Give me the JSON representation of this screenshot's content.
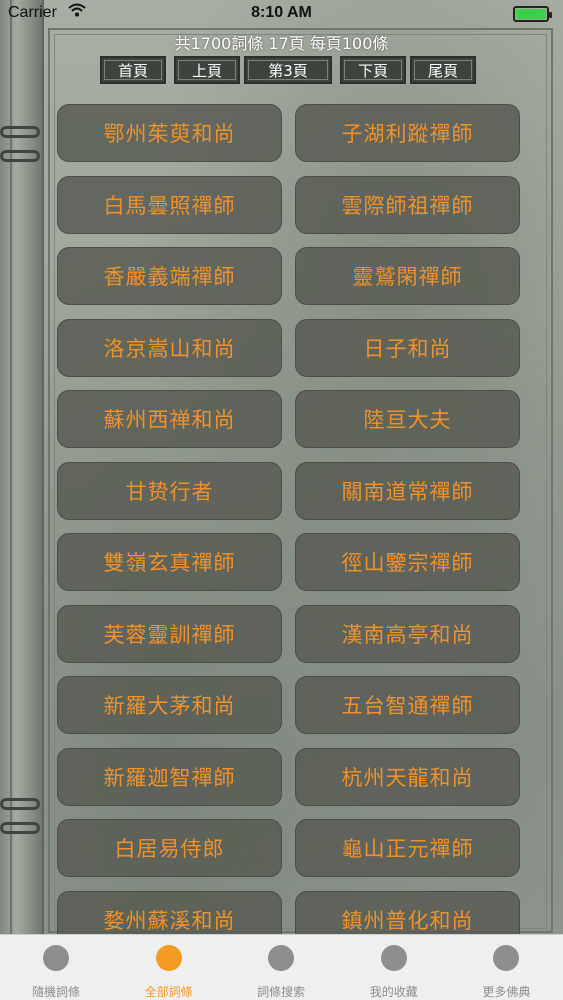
{
  "status_bar": {
    "carrier": "Carrier",
    "time": "8:10 AM"
  },
  "summary": "共1700詞條 17頁 每頁100條",
  "pager": {
    "first": "首頁",
    "prev": "上頁",
    "current": "第3頁",
    "next": "下頁",
    "last": "尾頁"
  },
  "names": [
    "鄂州茱萸和尚",
    "子湖利蹤禪師",
    "白馬曇照禪師",
    "雲際師祖禪師",
    "香嚴義端禪師",
    "靈鷲閑禪師",
    "洛京嵩山和尚",
    "日子和尚",
    "蘇州西禅和尚",
    "陸亘大夫",
    "甘贽行者",
    "關南道常禪師",
    "雙嶺玄真禪師",
    "徑山鑒宗禪師",
    "芙蓉靈訓禪師",
    "漢南高亭和尚",
    "新羅大茅和尚",
    "五台智通禪師",
    "新羅迦智禪師",
    "杭州天龍和尚",
    "白居易侍郎",
    "龜山正元禪師",
    "婺州蘇溪和尚",
    "鎮州普化和尚"
  ],
  "tabs": [
    {
      "label": "隨機詞條",
      "active": false
    },
    {
      "label": "全部詞條",
      "active": true
    },
    {
      "label": "詞條搜索",
      "active": false
    },
    {
      "label": "我的收藏",
      "active": false
    },
    {
      "label": "更多佛典",
      "active": false
    }
  ],
  "colors": {
    "accent": "#f59a23",
    "name_text": "#f0922a",
    "inactive_tab": "#8e8e8e"
  }
}
